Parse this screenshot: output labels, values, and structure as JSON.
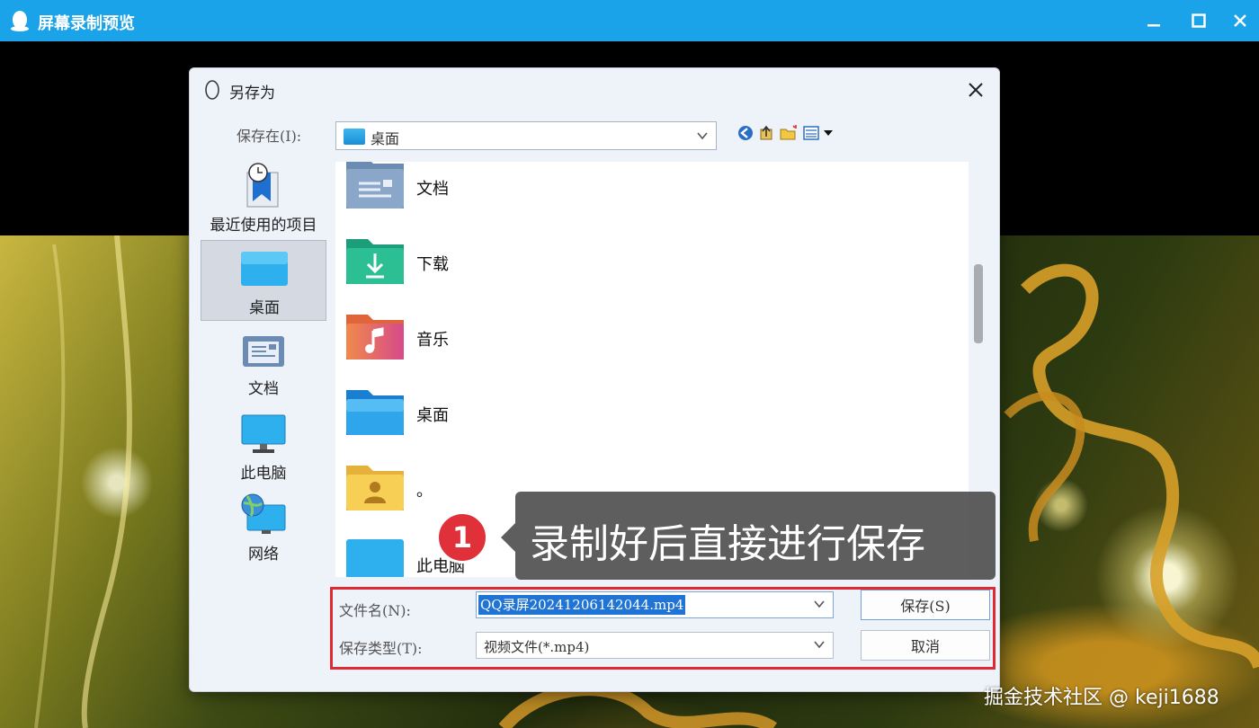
{
  "app": {
    "title": "屏幕录制预览",
    "accent": "#1aa3e8"
  },
  "dialog": {
    "title": "另存为",
    "save_in_label": "保存在(I):",
    "save_in_value": "桌面",
    "places": [
      {
        "label": "最近使用的项目",
        "icon": "recent-icon"
      },
      {
        "label": "桌面",
        "icon": "desktop-icon"
      },
      {
        "label": "文档",
        "icon": "documents-icon"
      },
      {
        "label": "此电脑",
        "icon": "computer-icon"
      },
      {
        "label": "网络",
        "icon": "network-icon"
      }
    ],
    "files": [
      {
        "name": "文档",
        "icon": "documents-folder-icon"
      },
      {
        "name": "下载",
        "icon": "downloads-folder-icon"
      },
      {
        "name": "音乐",
        "icon": "music-folder-icon"
      },
      {
        "name": "桌面",
        "icon": "desktop-folder-icon"
      },
      {
        "name": "。",
        "icon": "user-folder-icon"
      },
      {
        "name": "此电脑",
        "icon": "computer-folder-icon"
      }
    ],
    "filename_label": "文件名(N):",
    "filename_value": "QQ录屏20241206142044.mp4",
    "filetype_label": "保存类型(T):",
    "filetype_value": "视频文件(*.mp4)",
    "save_button": "保存(S)",
    "cancel_button": "取消"
  },
  "callout": {
    "step": "1",
    "text": "录制好后直接进行保存"
  },
  "watermark": "掘金技术社区 @ keji1688"
}
